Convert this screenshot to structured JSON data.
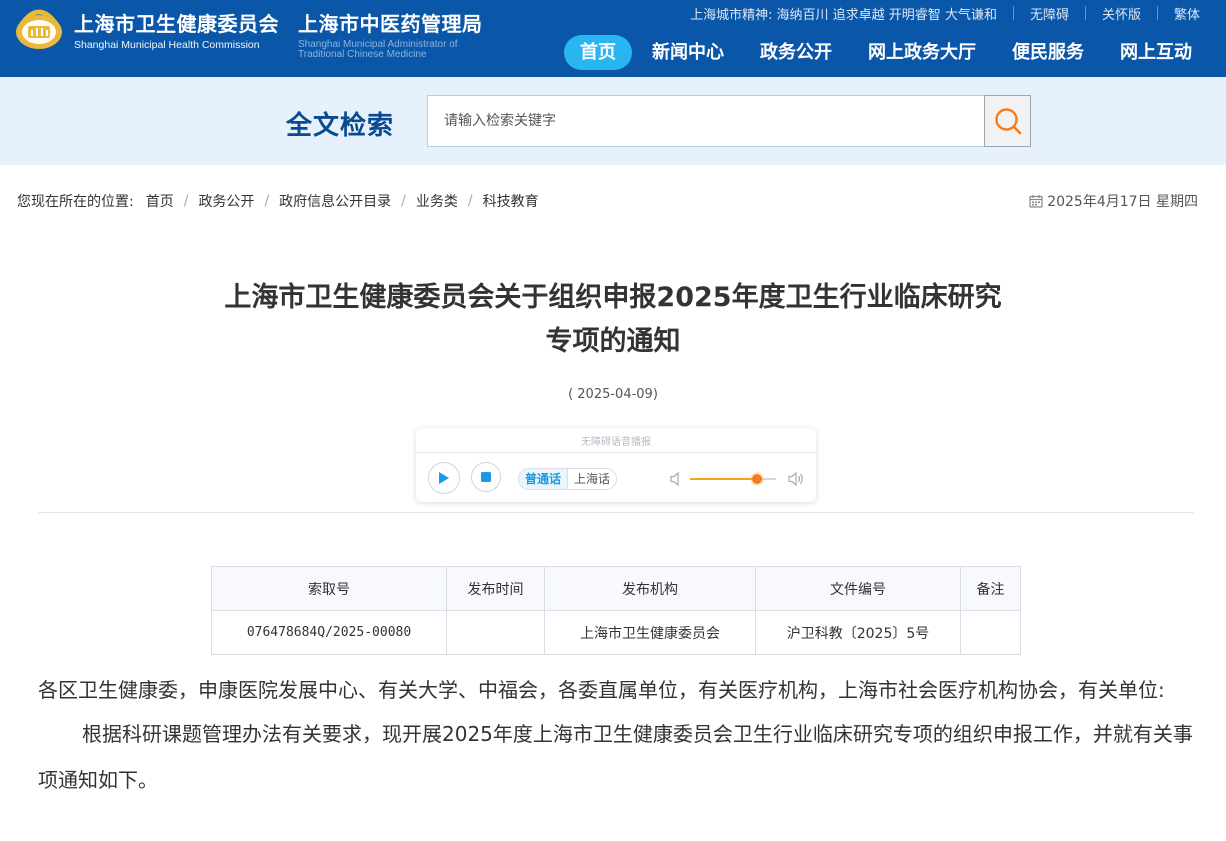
{
  "header": {
    "brand1_cn": "上海市卫生健康委员会",
    "brand1_en": "Shanghai Municipal Health Commission",
    "brand2_cn": "上海市中医药管理局",
    "brand2_en": "Shanghai Municipal Administrator of Traditional Chinese Medicine",
    "slogan_label": "上海城市精神:",
    "slogan_text": "海纳百川 追求卓越 开明睿智 大气谦和",
    "top_links": [
      "无障碍",
      "关怀版",
      "繁体"
    ],
    "nav": [
      "首页",
      "新闻中心",
      "政务公开",
      "网上政务大厅",
      "便民服务",
      "网上互动"
    ],
    "active_nav": "首页",
    "colors": {
      "header_bg": "#0a56a8",
      "active_nav": "#29b6f0"
    }
  },
  "search": {
    "title": "全文检索",
    "placeholder": "请输入检索关键字",
    "icon": "search-icon"
  },
  "breadcrumb": {
    "label": "您现在所在的位置:",
    "items": [
      "首页",
      "政务公开",
      "政府信息公开目录",
      "业务类",
      "科技教育"
    ],
    "separator": "/"
  },
  "date": {
    "text": "2025年4月17日 星期四",
    "icon": "calendar-icon"
  },
  "article": {
    "title_line1": "上海市卫生健康委员会关于组织申报2025年度卫生行业临床研究",
    "title_line2": "专项的通知",
    "pub_date": "( 2025-04-09)"
  },
  "player": {
    "hint": "无障碍语音播报",
    "lang_active": "普通话",
    "lang_other": "上海话",
    "volume": 0.78
  },
  "meta": {
    "headers": [
      "索取号",
      "发布时间",
      "发布机构",
      "文件编号",
      "备注"
    ],
    "values": [
      "076478684Q/2025-00080",
      "",
      "上海市卫生健康委员会",
      "沪卫科教〔2025〕5号",
      ""
    ]
  },
  "content": {
    "para1": "各区卫生健康委，申康医院发展中心、有关大学、中福会，各委直属单位，有关医疗机构，上海市社会医疗机构协会，有关单位:",
    "para2": "根据科研课题管理办法有关要求，现开展2025年度上海市卫生健康委员会卫生行业临床研究专项的组织申报工作，并就有关事项通知如下。"
  }
}
